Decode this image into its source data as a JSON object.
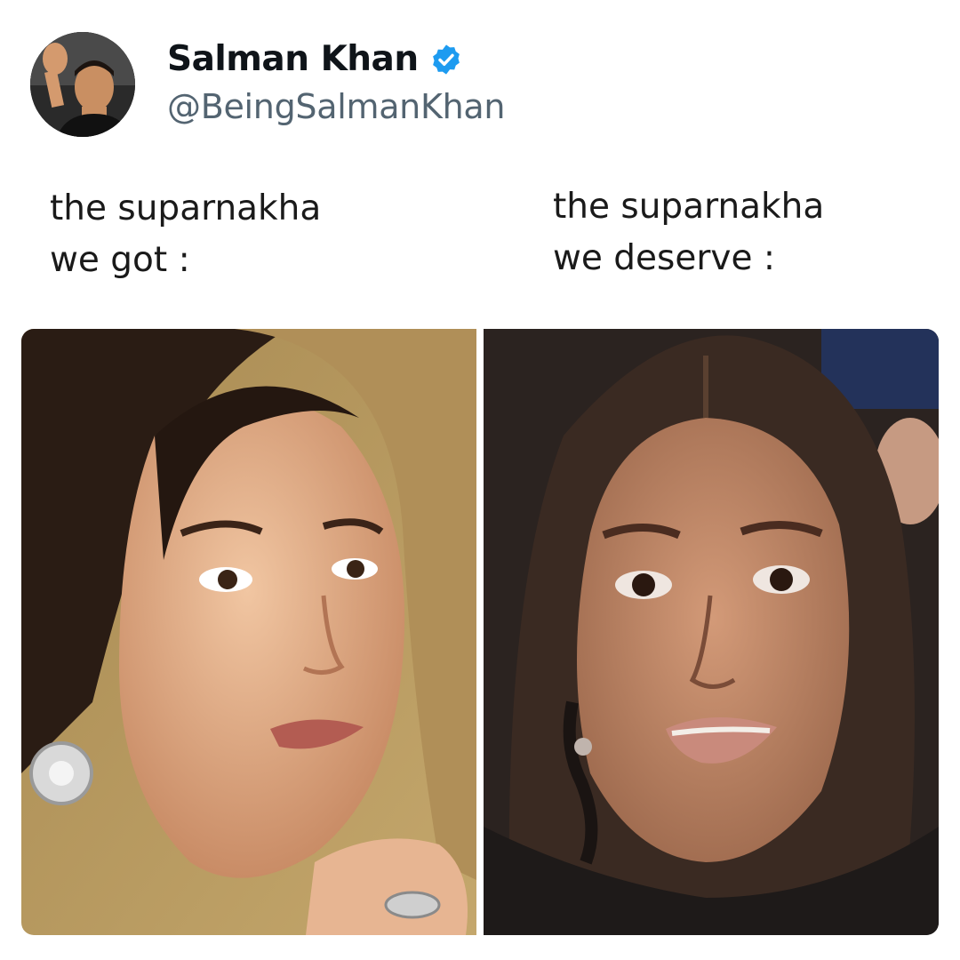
{
  "tweet": {
    "display_name": "Salman Khan",
    "handle": "@BeingSalmanKhan",
    "verified": true,
    "avatar_icon": "profile-avatar"
  },
  "captions": {
    "left": {
      "line1": "the suparnakha",
      "line2": "we got :"
    },
    "right": {
      "line1": "the suparnakha",
      "line2": "we deserve  :"
    }
  },
  "images": {
    "left": {
      "subject": "woman-portrait-photo",
      "background_color": "#b89a5e"
    },
    "right": {
      "subject": "woman-portrait-photo",
      "background_color": "#2b2320"
    }
  },
  "colors": {
    "verified_badge": "#1d9bf0",
    "handle": "#536471",
    "name": "#0f1419"
  }
}
